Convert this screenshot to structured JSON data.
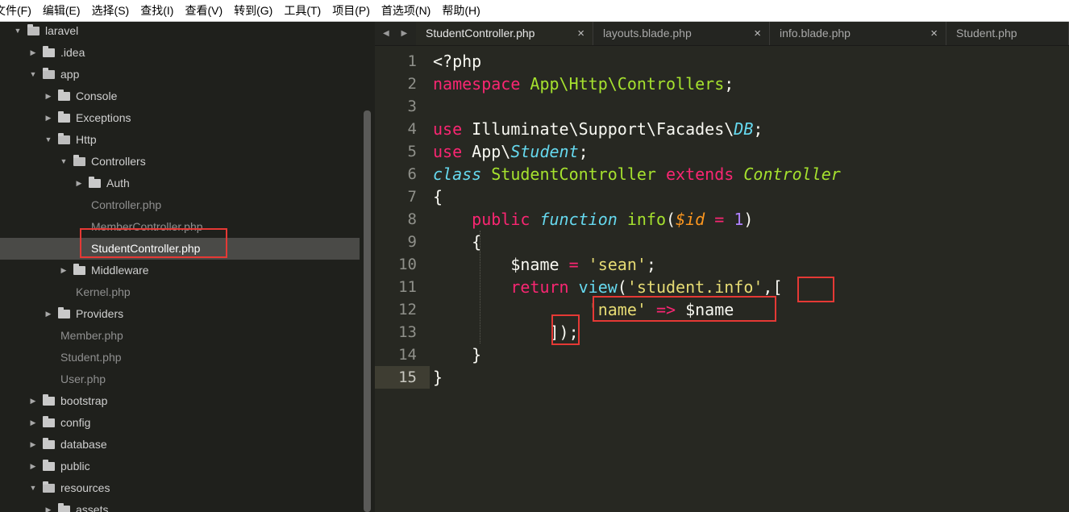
{
  "menu": [
    "文件(F)",
    "编辑(E)",
    "选择(S)",
    "查找(I)",
    "查看(V)",
    "转到(G)",
    "工具(T)",
    "项目(P)",
    "首选项(N)",
    "帮助(H)"
  ],
  "tree": [
    {
      "label": "laravel",
      "kind": "folder",
      "open": true,
      "depth": 0
    },
    {
      "label": ".idea",
      "kind": "folder",
      "open": false,
      "depth": 1
    },
    {
      "label": "app",
      "kind": "folder",
      "open": true,
      "depth": 1
    },
    {
      "label": "Console",
      "kind": "folder",
      "open": false,
      "depth": 2
    },
    {
      "label": "Exceptions",
      "kind": "folder",
      "open": false,
      "depth": 2
    },
    {
      "label": "Http",
      "kind": "folder",
      "open": true,
      "depth": 2
    },
    {
      "label": "Controllers",
      "kind": "folder",
      "open": true,
      "depth": 3
    },
    {
      "label": "Auth",
      "kind": "folder",
      "open": false,
      "depth": 4
    },
    {
      "label": "Controller.php",
      "kind": "file",
      "depth": 4
    },
    {
      "label": "MemberController.php",
      "kind": "file",
      "depth": 4
    },
    {
      "label": "StudentController.php",
      "kind": "file",
      "depth": 4,
      "selected": true
    },
    {
      "label": "Middleware",
      "kind": "folder",
      "open": false,
      "depth": 3
    },
    {
      "label": "Kernel.php",
      "kind": "file",
      "depth": 3
    },
    {
      "label": "Providers",
      "kind": "folder",
      "open": false,
      "depth": 2
    },
    {
      "label": "Member.php",
      "kind": "file",
      "depth": 2
    },
    {
      "label": "Student.php",
      "kind": "file",
      "depth": 2
    },
    {
      "label": "User.php",
      "kind": "file",
      "depth": 2
    },
    {
      "label": "bootstrap",
      "kind": "folder",
      "open": false,
      "depth": 1
    },
    {
      "label": "config",
      "kind": "folder",
      "open": false,
      "depth": 1
    },
    {
      "label": "database",
      "kind": "folder",
      "open": false,
      "depth": 1
    },
    {
      "label": "public",
      "kind": "folder",
      "open": false,
      "depth": 1
    },
    {
      "label": "resources",
      "kind": "folder",
      "open": true,
      "depth": 1
    },
    {
      "label": "assets",
      "kind": "folder",
      "open": false,
      "depth": 2
    }
  ],
  "tab_nav": "◀ ▶",
  "tabs": [
    {
      "label": "StudentController.php",
      "active": true,
      "close": "×"
    },
    {
      "label": "layouts.blade.php",
      "active": false,
      "close": "×"
    },
    {
      "label": "info.blade.php",
      "active": false,
      "close": "×"
    },
    {
      "label": "Student.php",
      "active": false,
      "close": ""
    }
  ],
  "active_line": 15,
  "code": [
    [
      [
        "w",
        "<?php"
      ]
    ],
    [
      [
        "k",
        "namespace"
      ],
      [
        "w",
        " "
      ],
      [
        "g",
        "App\\Http\\Controllers"
      ],
      [
        "w",
        ";"
      ]
    ],
    [],
    [
      [
        "k",
        "use"
      ],
      [
        "w",
        " Illuminate\\Support\\Facades\\"
      ],
      [
        "kb",
        "DB"
      ],
      [
        "w",
        ";"
      ]
    ],
    [
      [
        "k",
        "use"
      ],
      [
        "w",
        " App\\"
      ],
      [
        "kb",
        "Student"
      ],
      [
        "w",
        ";"
      ]
    ],
    [
      [
        "kb",
        "class"
      ],
      [
        "w",
        " "
      ],
      [
        "g",
        "StudentController"
      ],
      [
        "w",
        " "
      ],
      [
        "k",
        "extends"
      ],
      [
        "w",
        " "
      ],
      [
        "gi",
        "Controller"
      ]
    ],
    [
      [
        "w",
        "{"
      ]
    ],
    [
      [
        "w",
        "    "
      ],
      [
        "k",
        "public"
      ],
      [
        "w",
        " "
      ],
      [
        "kb",
        "function"
      ],
      [
        "w",
        " "
      ],
      [
        "g",
        "info"
      ],
      [
        "w",
        "("
      ],
      [
        "o",
        "$id"
      ],
      [
        "w",
        " "
      ],
      [
        "k",
        "="
      ],
      [
        "w",
        " "
      ],
      [
        "p",
        "1"
      ],
      [
        "w",
        ")"
      ]
    ],
    [
      [
        "w",
        "    {"
      ]
    ],
    [
      [
        "w",
        "        $name "
      ],
      [
        "k",
        "="
      ],
      [
        "w",
        " "
      ],
      [
        "s",
        "'sean'"
      ],
      [
        "w",
        ";"
      ]
    ],
    [
      [
        "w",
        "        "
      ],
      [
        "k",
        "return"
      ],
      [
        "w",
        " "
      ],
      [
        "cyan",
        "view"
      ],
      [
        "w",
        "("
      ],
      [
        "s",
        "'student.info'"
      ],
      [
        "w",
        ",["
      ]
    ],
    [
      [
        "w",
        "                "
      ],
      [
        "s",
        "'name'"
      ],
      [
        "w",
        " "
      ],
      [
        "k",
        "=>"
      ],
      [
        "w",
        " $name"
      ]
    ],
    [
      [
        "w",
        "            ]);"
      ]
    ],
    [
      [
        "w",
        "    }"
      ]
    ],
    [
      [
        "w",
        "}"
      ]
    ]
  ]
}
